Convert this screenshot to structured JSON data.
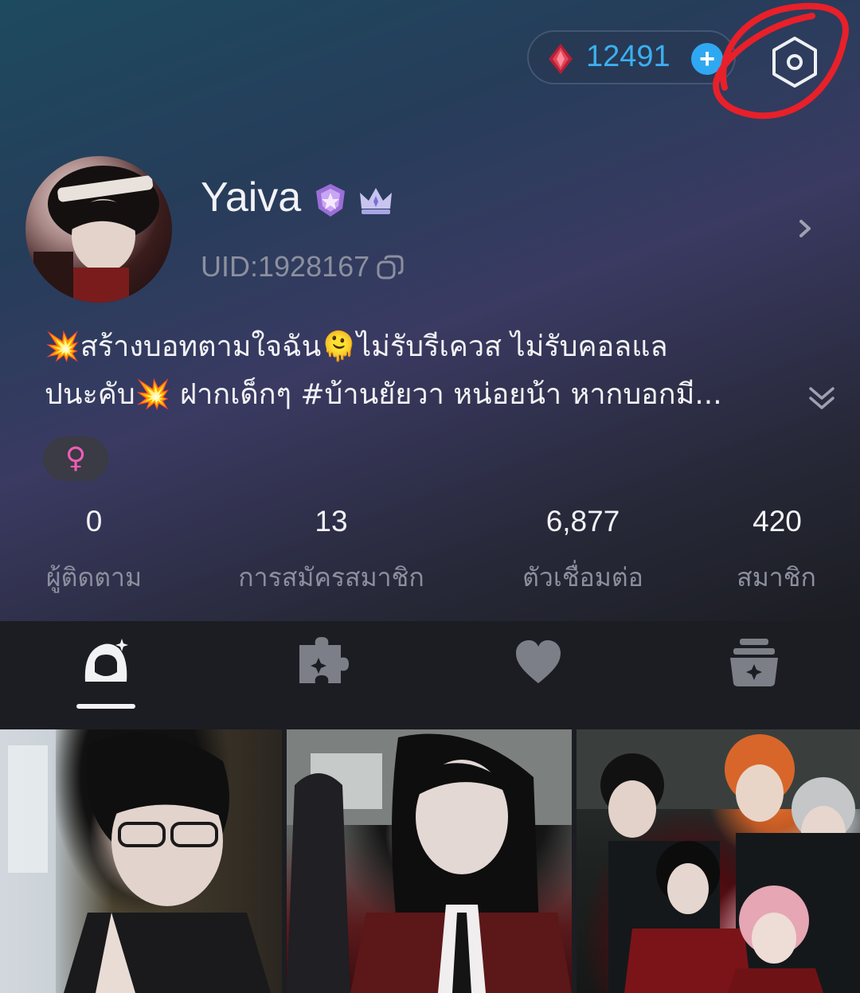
{
  "top_bar": {
    "coin_count": "12491",
    "plus_label": "+",
    "icons": {
      "currency": "ruby-gem-icon",
      "settings": "settings-hexagon-icon"
    }
  },
  "profile": {
    "username": "Yaiva",
    "uid": "UID:1928167",
    "gender_symbol": "♀",
    "bio_lines": [
      "💥สร้างบอทตามใจฉัน🫠ไม่รับรีเควส ไม่รับคอลแล",
      "ปนะคับ💥 ฝากเด็กๆ #บ้านยัยวา หน่อยน้า หากบอกมี..."
    ]
  },
  "stats": [
    {
      "value": "0",
      "label": "ผู้ติดตาม"
    },
    {
      "value": "13",
      "label": "การสมัครสมาชิก"
    },
    {
      "value": "6,877",
      "label": "ตัวเชื่อมต่อ"
    },
    {
      "value": "420",
      "label": "สมาชิก"
    }
  ],
  "tabs": [
    {
      "icon": "character-icon",
      "active": true
    },
    {
      "icon": "puzzle-icon",
      "active": false
    },
    {
      "icon": "heart-icon",
      "active": false
    },
    {
      "icon": "archive-box-icon",
      "active": false
    }
  ],
  "colors": {
    "accent_blue": "#2fa8f2",
    "annotation_red": "#e8202a",
    "gender_pink": "#ee5db4"
  }
}
